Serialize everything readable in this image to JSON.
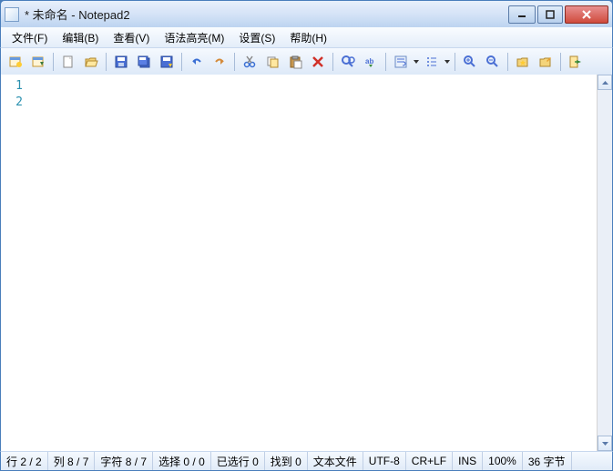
{
  "titlebar": {
    "title": "* 未命名 - Notepad2"
  },
  "menu": {
    "file": "文件(F)",
    "edit": "编辑(B)",
    "view": "查看(V)",
    "syntax": "语法高亮(M)",
    "settings": "设置(S)",
    "help": "帮助(H)"
  },
  "toolbar_icons": {
    "i1": "new-window",
    "i2": "open-in",
    "i3": "new",
    "i4": "open",
    "i5": "save",
    "i6": "save-all",
    "i7": "save-as",
    "i8": "undo",
    "i9": "redo",
    "i10": "cut",
    "i11": "copy",
    "i12": "paste",
    "i13": "delete",
    "i14": "find",
    "i15": "replace",
    "i16": "word-wrap",
    "i17": "list",
    "i18": "zoom-in",
    "i19": "zoom-out",
    "i20": "favorites",
    "i21": "edit-fav",
    "i22": "exit"
  },
  "editor": {
    "lines": [
      "1",
      "2"
    ],
    "content": [
      "",
      ""
    ]
  },
  "status": {
    "line": "行 2 / 2",
    "col": "列 8 / 7",
    "char": "字符 8 / 7",
    "sel": "选择 0 / 0",
    "sellines": "已选行 0",
    "find": "找到 0",
    "filetype": "文本文件",
    "encoding": "UTF-8",
    "eol": "CR+LF",
    "mode": "INS",
    "zoom": "100%",
    "bytes": "36 字节"
  }
}
